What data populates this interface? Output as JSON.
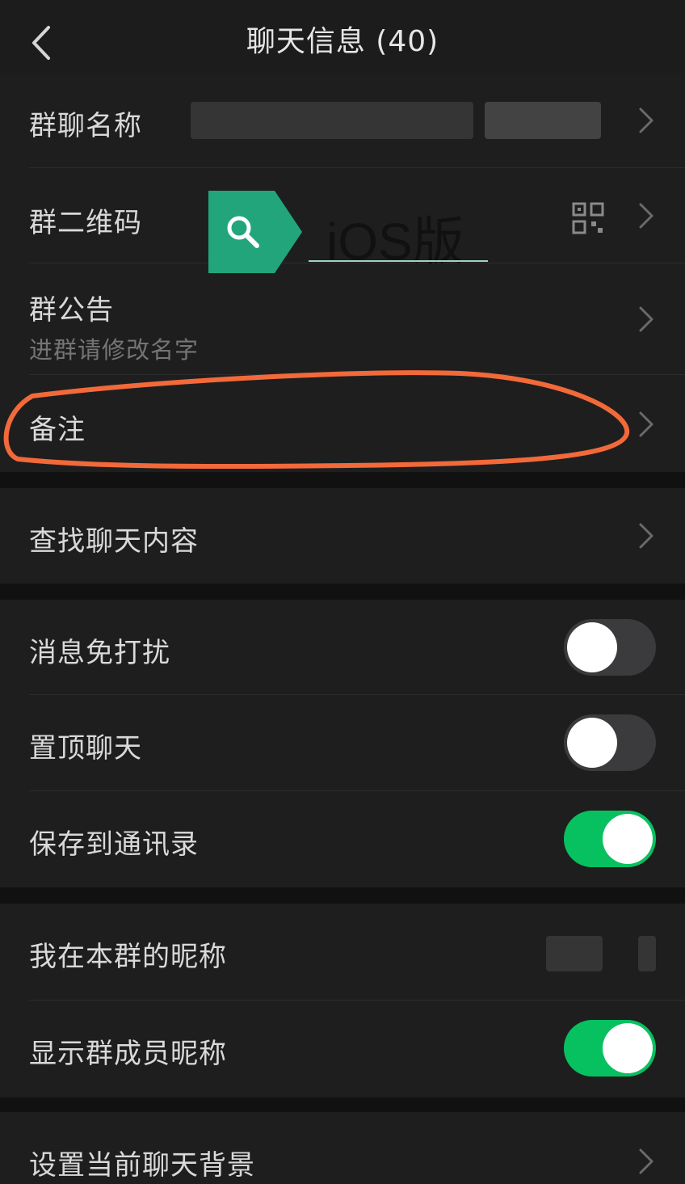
{
  "nav": {
    "title": "聊天信息 (40)"
  },
  "group1": {
    "name_label": "群聊名称",
    "qrcode_label": "群二维码",
    "notice_label": "群公告",
    "notice_value": "进群请修改名字",
    "remark_label": "备注"
  },
  "badge": {
    "text": "iOS版"
  },
  "group2": {
    "search_label": "查找聊天内容"
  },
  "group3": {
    "mute_label": "消息免打扰",
    "mute_on": false,
    "sticky_label": "置顶聊天",
    "sticky_on": false,
    "save_label": "保存到通讯录",
    "save_on": true
  },
  "group4": {
    "nickname_label": "我在本群的昵称",
    "show_nick_label": "显示群成员昵称",
    "show_nick_on": true
  },
  "group5": {
    "bg_label": "设置当前聊天背景"
  },
  "colors": {
    "accent": "#07c160",
    "badge": "#22a57b",
    "annotation": "#f2693a"
  },
  "icons": [
    "back-icon",
    "chevron-right-icon",
    "qr-code-icon",
    "search-icon"
  ]
}
